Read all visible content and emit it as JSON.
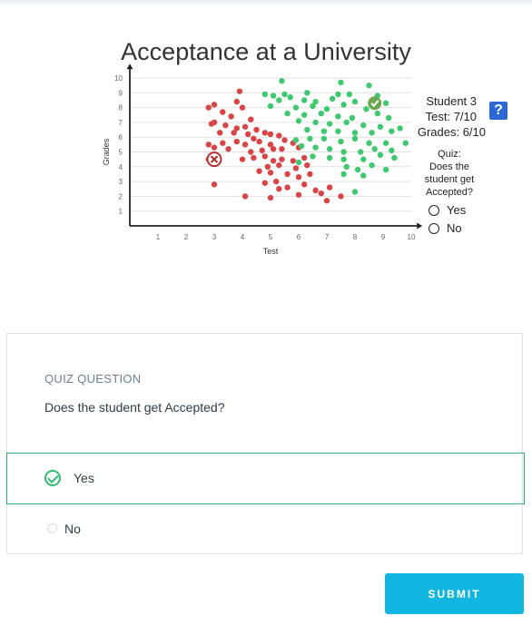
{
  "figure": {
    "title": "Acceptance at a University",
    "student": {
      "name": "Student 3",
      "test": "Test: 7/10",
      "grades": "Grades: 6/10"
    },
    "help_icon_text": "?",
    "mini_quiz": {
      "lines": [
        "Quiz:",
        "Does the",
        "student get",
        "Accepted?"
      ],
      "yes": "Yes",
      "no": "No"
    }
  },
  "chart_data": {
    "type": "scatter",
    "xlabel": "Test",
    "ylabel": "Grades",
    "xlim": [
      0,
      10
    ],
    "ylim": [
      0,
      10
    ],
    "xticks": [
      "1",
      "2",
      "3",
      "4",
      "5",
      "6",
      "7",
      "8",
      "9",
      "10"
    ],
    "yticks": [
      "1",
      "2",
      "3",
      "4",
      "5",
      "6",
      "7",
      "8",
      "9",
      "10"
    ],
    "colors": {
      "accepted": "#3ec96e",
      "rejected": "#d94545",
      "check": "#6aa84f"
    },
    "series": [
      {
        "values": [
          [
            2.8,
            8.0
          ],
          [
            3.0,
            8.2
          ],
          [
            3.9,
            9.1
          ],
          [
            3.8,
            8.4
          ],
          [
            4.0,
            8.0
          ],
          [
            3.3,
            7.7
          ],
          [
            3.6,
            7.4
          ],
          [
            4.3,
            7.2
          ],
          [
            3.0,
            7.0
          ],
          [
            2.9,
            6.9
          ],
          [
            3.4,
            6.8
          ],
          [
            3.8,
            6.6
          ],
          [
            4.1,
            6.7
          ],
          [
            4.5,
            6.5
          ],
          [
            3.2,
            6.3
          ],
          [
            3.7,
            6.3
          ],
          [
            4.2,
            6.2
          ],
          [
            4.8,
            6.3
          ],
          [
            5.0,
            6.2
          ],
          [
            5.3,
            6.1
          ],
          [
            4.4,
            5.9
          ],
          [
            2.8,
            5.5
          ],
          [
            3.3,
            5.6
          ],
          [
            3.8,
            5.7
          ],
          [
            4.1,
            5.5
          ],
          [
            4.6,
            5.7
          ],
          [
            5.0,
            5.5
          ],
          [
            5.5,
            5.8
          ],
          [
            5.8,
            5.6
          ],
          [
            3.0,
            5.3
          ],
          [
            3.5,
            5.2
          ],
          [
            4.3,
            5.0
          ],
          [
            4.7,
            5.1
          ],
          [
            5.1,
            5.2
          ],
          [
            5.4,
            5.2
          ],
          [
            6.0,
            5.3
          ],
          [
            2.8,
            4.5
          ],
          [
            3.1,
            4.5
          ],
          [
            4.0,
            4.5
          ],
          [
            4.4,
            4.6
          ],
          [
            4.8,
            4.7
          ],
          [
            5.1,
            4.4
          ],
          [
            5.4,
            4.5
          ],
          [
            5.8,
            4.4
          ],
          [
            6.2,
            4.6
          ],
          [
            4.9,
            4.0
          ],
          [
            5.3,
            4.1
          ],
          [
            5.9,
            3.9
          ],
          [
            6.3,
            4.1
          ],
          [
            4.6,
            3.7
          ],
          [
            5.0,
            3.6
          ],
          [
            5.6,
            3.5
          ],
          [
            6.0,
            3.3
          ],
          [
            6.4,
            3.5
          ],
          [
            3.0,
            2.8
          ],
          [
            4.8,
            2.9
          ],
          [
            5.2,
            3.0
          ],
          [
            5.6,
            2.6
          ],
          [
            6.2,
            2.8
          ],
          [
            6.6,
            2.4
          ],
          [
            7.1,
            2.6
          ],
          [
            6.8,
            2.2
          ],
          [
            7.5,
            2.0
          ],
          [
            5.3,
            2.5
          ],
          [
            6.0,
            2.1
          ],
          [
            7.0,
            1.7
          ],
          [
            4.1,
            2.0
          ],
          [
            5.0,
            1.9
          ]
        ]
      },
      {
        "values": [
          [
            5.4,
            9.8
          ],
          [
            7.5,
            9.7
          ],
          [
            8.5,
            9.5
          ],
          [
            4.8,
            8.9
          ],
          [
            5.1,
            8.8
          ],
          [
            5.5,
            8.9
          ],
          [
            5.7,
            8.7
          ],
          [
            6.3,
            9.0
          ],
          [
            7.4,
            8.9
          ],
          [
            7.8,
            8.9
          ],
          [
            8.8,
            8.8
          ],
          [
            9.1,
            8.3
          ],
          [
            5.3,
            8.5
          ],
          [
            6.2,
            8.5
          ],
          [
            6.6,
            8.4
          ],
          [
            7.2,
            8.6
          ],
          [
            8.0,
            8.4
          ],
          [
            5.0,
            8.1
          ],
          [
            5.9,
            8.0
          ],
          [
            6.5,
            8.1
          ],
          [
            7.0,
            7.9
          ],
          [
            7.6,
            8.2
          ],
          [
            8.4,
            7.9
          ],
          [
            8.8,
            7.6
          ],
          [
            9.2,
            7.3
          ],
          [
            5.6,
            7.6
          ],
          [
            6.2,
            7.5
          ],
          [
            6.8,
            7.6
          ],
          [
            7.4,
            7.4
          ],
          [
            7.9,
            7.3
          ],
          [
            6.0,
            7.1
          ],
          [
            6.6,
            7.0
          ],
          [
            7.1,
            6.9
          ],
          [
            7.7,
            7.0
          ],
          [
            8.3,
            6.8
          ],
          [
            8.9,
            6.7
          ],
          [
            9.6,
            6.6
          ],
          [
            6.3,
            6.5
          ],
          [
            6.9,
            6.4
          ],
          [
            7.4,
            6.4
          ],
          [
            8.0,
            6.3
          ],
          [
            8.6,
            6.3
          ],
          [
            9.3,
            6.4
          ],
          [
            5.9,
            5.8
          ],
          [
            6.4,
            5.9
          ],
          [
            6.9,
            5.9
          ],
          [
            7.5,
            5.7
          ],
          [
            8.0,
            5.9
          ],
          [
            8.5,
            5.6
          ],
          [
            9.1,
            5.6
          ],
          [
            9.8,
            5.6
          ],
          [
            6.1,
            5.4
          ],
          [
            6.6,
            5.3
          ],
          [
            7.1,
            5.2
          ],
          [
            7.6,
            5.0
          ],
          [
            8.2,
            5.0
          ],
          [
            8.7,
            5.2
          ],
          [
            9.3,
            5.1
          ],
          [
            6.5,
            4.7
          ],
          [
            7.1,
            4.6
          ],
          [
            7.6,
            4.5
          ],
          [
            8.3,
            4.5
          ],
          [
            8.9,
            4.8
          ],
          [
            9.4,
            4.6
          ],
          [
            6.0,
            4.3
          ],
          [
            7.7,
            4.0
          ],
          [
            8.1,
            3.8
          ],
          [
            8.6,
            4.1
          ],
          [
            9.1,
            3.8
          ],
          [
            7.6,
            3.5
          ],
          [
            8.3,
            3.4
          ],
          [
            8.0,
            2.3
          ]
        ]
      }
    ],
    "markers": [
      {
        "type": "rejected-x",
        "x": 3.0,
        "y": 4.5
      },
      {
        "type": "accepted-check",
        "x": 8.7,
        "y": 8.3
      }
    ]
  },
  "quiz": {
    "label": "QUIZ QUESTION",
    "question": "Does the student get Accepted?",
    "options": [
      {
        "label": "Yes",
        "selected": true
      },
      {
        "label": "No",
        "selected": false
      }
    ],
    "submit_label": "SUBMIT"
  }
}
